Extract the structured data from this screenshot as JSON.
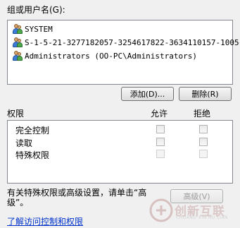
{
  "users": {
    "label": "组或用户名(G):",
    "items": [
      {
        "name": "SYSTEM",
        "icon": "users-icon"
      },
      {
        "name": "S-1-5-21-3277182057-3254617822-3634110157-1005",
        "icon": "users-icon"
      },
      {
        "name": "Administrators (OO-PC\\Administrators)",
        "icon": "users-icon"
      }
    ]
  },
  "buttons": {
    "add": "添加(D)...",
    "remove": "删除(R)",
    "advanced": "高级(V)"
  },
  "permissions": {
    "header": "权限",
    "allow_header": "允许",
    "deny_header": "拒绝",
    "rows": [
      {
        "label": "完全控制"
      },
      {
        "label": "读取"
      },
      {
        "label": "特殊权限"
      }
    ]
  },
  "advanced_note": "有关特殊权限或高级设置，请单击“高级”。",
  "learn_link": "了解访问控制和权限",
  "watermark": {
    "text": "创新互联",
    "sub": "CHUANG XIN HU LIAN"
  }
}
